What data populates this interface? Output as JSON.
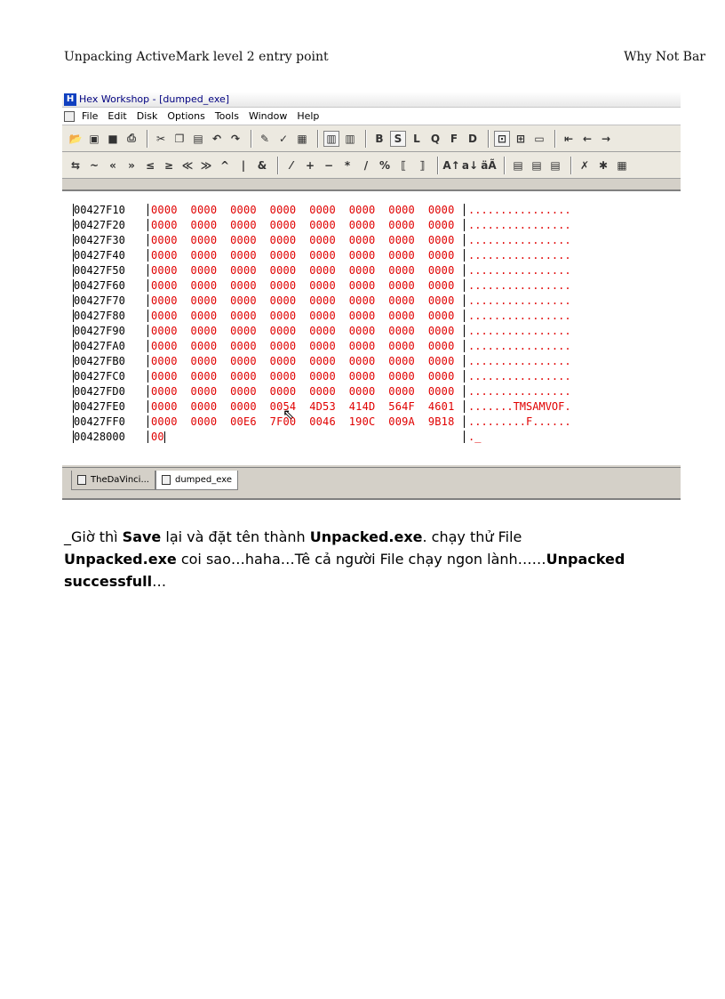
{
  "header": {
    "left": "Unpacking ActiveMark level 2 entry point",
    "right": "Why Not Bar"
  },
  "window": {
    "title": "Hex Workshop - [dumped_exe]",
    "menu": [
      "File",
      "Edit",
      "Disk",
      "Options",
      "Tools",
      "Window",
      "Help"
    ],
    "toolbar1": {
      "buttons": [
        "open-icon",
        "save-icon",
        "disk-icon",
        "print-icon",
        "cut-icon",
        "copy-icon",
        "paste-icon",
        "undo-icon",
        "redo-icon",
        "find-icon",
        "replace-icon",
        "properties-icon",
        "view16-icon",
        "view10-icon"
      ],
      "letters": [
        "B",
        "S",
        "L",
        "Q",
        "F",
        "D"
      ]
    },
    "toolbar2": {
      "symbols": [
        "⇆",
        "~",
        "«",
        "»",
        "≤",
        "≥",
        "≪",
        "≫",
        "^",
        "|",
        "&",
        "⁄",
        "+",
        "−",
        "*",
        "/",
        "%",
        "⟦",
        "⟧"
      ]
    },
    "hex_rows": [
      {
        "addr": "00427F10",
        "bytes": "0000  0000  0000  0000  0000  0000  0000  0000",
        "ascii": "................"
      },
      {
        "addr": "00427F20",
        "bytes": "0000  0000  0000  0000  0000  0000  0000  0000",
        "ascii": "................"
      },
      {
        "addr": "00427F30",
        "bytes": "0000  0000  0000  0000  0000  0000  0000  0000",
        "ascii": "................"
      },
      {
        "addr": "00427F40",
        "bytes": "0000  0000  0000  0000  0000  0000  0000  0000",
        "ascii": "................"
      },
      {
        "addr": "00427F50",
        "bytes": "0000  0000  0000  0000  0000  0000  0000  0000",
        "ascii": "................"
      },
      {
        "addr": "00427F60",
        "bytes": "0000  0000  0000  0000  0000  0000  0000  0000",
        "ascii": "................"
      },
      {
        "addr": "00427F70",
        "bytes": "0000  0000  0000  0000  0000  0000  0000  0000",
        "ascii": "................"
      },
      {
        "addr": "00427F80",
        "bytes": "0000  0000  0000  0000  0000  0000  0000  0000",
        "ascii": "................"
      },
      {
        "addr": "00427F90",
        "bytes": "0000  0000  0000  0000  0000  0000  0000  0000",
        "ascii": "................"
      },
      {
        "addr": "00427FA0",
        "bytes": "0000  0000  0000  0000  0000  0000  0000  0000",
        "ascii": "................"
      },
      {
        "addr": "00427FB0",
        "bytes": "0000  0000  0000  0000  0000  0000  0000  0000",
        "ascii": "................"
      },
      {
        "addr": "00427FC0",
        "bytes": "0000  0000  0000  0000  0000  0000  0000  0000",
        "ascii": "................"
      },
      {
        "addr": "00427FD0",
        "bytes": "0000  0000  0000  0000  0000  0000  0000  0000",
        "ascii": "................"
      },
      {
        "addr": "00427FE0",
        "bytes": "0000  0000  0000  0054  4D53  414D  564F  4601",
        "ascii": ".......TMSAMVOF."
      },
      {
        "addr": "00427FF0",
        "bytes": "0000  0000  00E6  7F00  0046  190C  009A  9B18",
        "ascii": ".........F......"
      },
      {
        "addr": "00428000",
        "bytes": "00",
        "ascii": "._"
      }
    ],
    "tabs": [
      "TheDaVinci...",
      "dumped_exe"
    ]
  },
  "paragraph": {
    "t1": "_Giờ thì ",
    "b1": "Save",
    "t2": " lại và đặt tên thành ",
    "b2": "Unpacked.exe",
    "t3": ".  chạy thử File ",
    "b3": "Unpacked.exe",
    "t4": " coi sao…haha…Tê cả người File chạy ngon lành……",
    "b4": "Unpacked successfull",
    "t5": "…"
  }
}
